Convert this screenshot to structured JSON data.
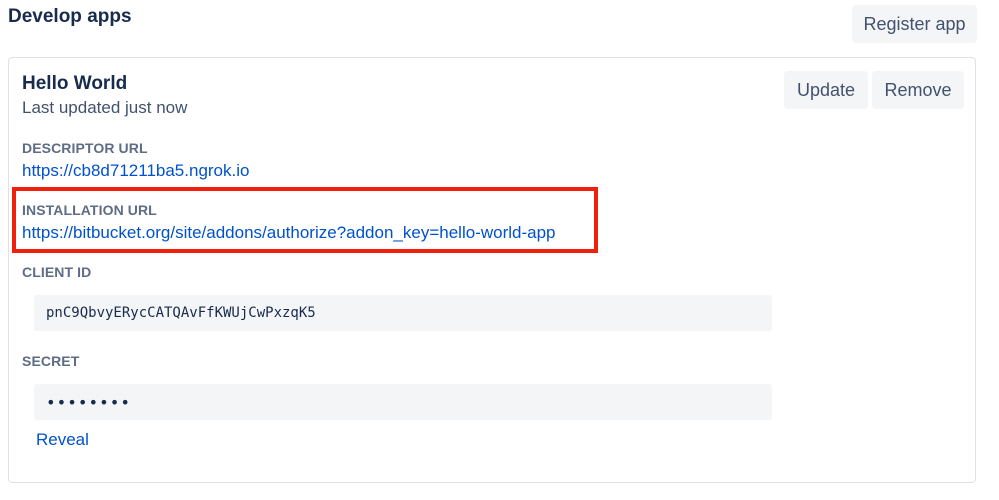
{
  "header": {
    "title": "Develop apps",
    "register_label": "Register app"
  },
  "app": {
    "name": "Hello World",
    "last_updated": "Last updated just now",
    "update_label": "Update",
    "remove_label": "Remove",
    "descriptor_label": "DESCRIPTOR URL",
    "descriptor_url": "https://cb8d71211ba5.ngrok.io",
    "installation_label": "INSTALLATION URL",
    "installation_url": "https://bitbucket.org/site/addons/authorize?addon_key=hello-world-app",
    "client_id_label": "CLIENT ID",
    "client_id": "pnC9QbvyERycCATQAvFfKWUjCwPxzqK5",
    "secret_label": "SECRET",
    "secret_masked": "••••••••",
    "reveal_label": "Reveal"
  },
  "colors": {
    "link": "#0052cc",
    "highlight": "#f0200c",
    "button_bg": "#f4f5f7"
  }
}
